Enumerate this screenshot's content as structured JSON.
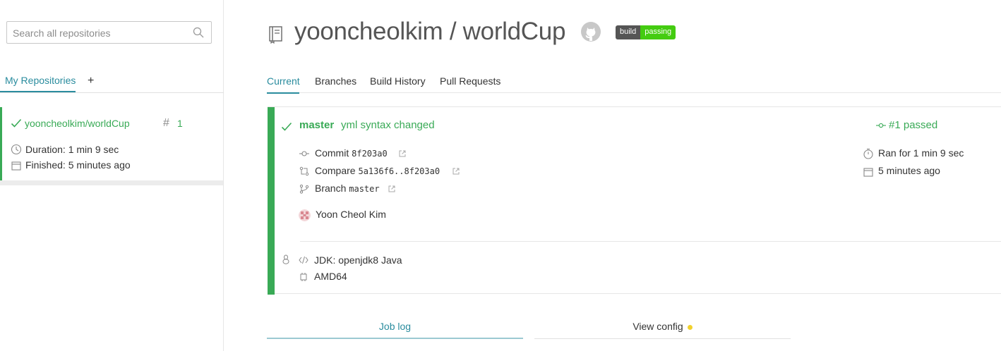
{
  "sidebar": {
    "search_placeholder": "Search all repositories",
    "tabs": {
      "my_repositories": "My Repositories",
      "add": "+"
    },
    "repo": {
      "name": "yooncheolkim/worldCup",
      "hash": "#",
      "build_number": "1",
      "duration": "Duration: 1 min 9 sec",
      "finished": "Finished: 5 minutes ago"
    }
  },
  "header": {
    "title": "yooncheolkim / worldCup",
    "badge": {
      "left": "build",
      "right": "passing"
    }
  },
  "tabs": [
    "Current",
    "Branches",
    "Build History",
    "Pull Requests"
  ],
  "build": {
    "branch": "master",
    "message": "yml syntax changed",
    "commit_label": "Commit",
    "commit_sha": "8f203a0",
    "compare_label": "Compare",
    "compare_range": "5a136f6..8f203a0",
    "branch_label": "Branch",
    "branch_name": "master",
    "author": "Yoon Cheol Kim",
    "status": "#1 passed",
    "ran_for": "Ran for 1 min 9 sec",
    "time_ago": "5 minutes ago",
    "jdk": "JDK: openjdk8 Java",
    "arch": "AMD64"
  },
  "bottom_tabs": {
    "job_log": "Job log",
    "view_config": "View config"
  },
  "colors": {
    "accent": "#2a8c9e",
    "passed": "#39aa56",
    "badge_dark": "#555555",
    "badge_green": "#44cc11",
    "config_dot": "#f1d12d"
  }
}
